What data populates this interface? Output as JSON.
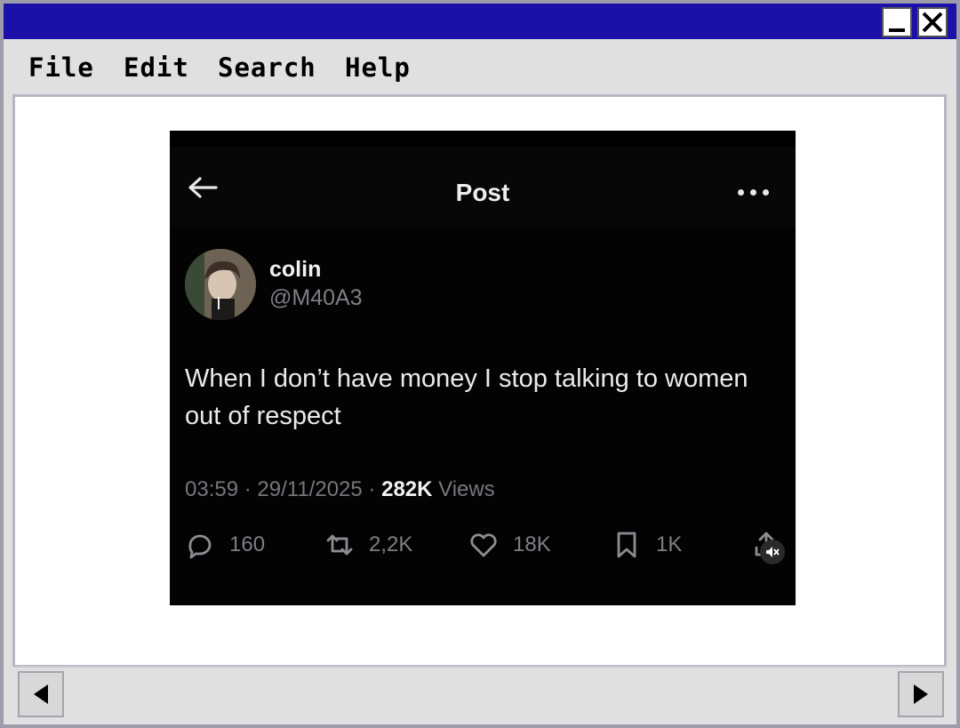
{
  "menu": {
    "file": "File",
    "edit": "Edit",
    "search": "Search",
    "help": "Help"
  },
  "post": {
    "header_title": "Post",
    "display_name": "colin",
    "handle": "@M40A3",
    "text": "When I don’t have money I stop talking to women out of respect",
    "time": "03:59",
    "date": "29/11/2025",
    "sep": "·",
    "views_count": "282K",
    "views_label": "Views",
    "replies": "160",
    "reposts": "2,2K",
    "likes": "18K",
    "bookmarks": "1K"
  },
  "colors": {
    "titlebar": "#1b10a8",
    "post_bg": "#040304",
    "muted_text": "#74777c"
  },
  "icons": [
    "minimize-icon",
    "close-icon",
    "back-arrow-icon",
    "more-icon",
    "reply-icon",
    "repost-icon",
    "like-icon",
    "bookmark-icon",
    "share-icon",
    "mute-icon",
    "scroll-left-icon",
    "scroll-right-icon"
  ]
}
